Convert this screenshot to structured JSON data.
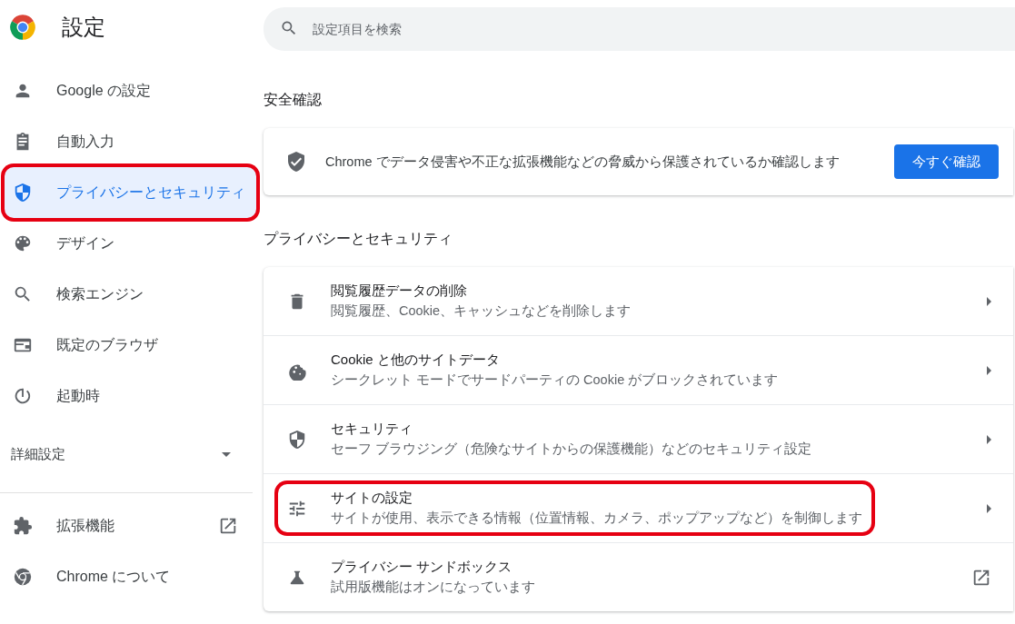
{
  "header": {
    "title": "設定"
  },
  "search": {
    "placeholder": "設定項目を検索"
  },
  "sidebar": {
    "items": [
      {
        "label": "Google の設定",
        "selected": false,
        "highlighted": false
      },
      {
        "label": "自動入力",
        "selected": false,
        "highlighted": false
      },
      {
        "label": "プライバシーとセキュリティ",
        "selected": true,
        "highlighted": true
      },
      {
        "label": "デザイン",
        "selected": false,
        "highlighted": false
      },
      {
        "label": "検索エンジン",
        "selected": false,
        "highlighted": false
      },
      {
        "label": "既定のブラウザ",
        "selected": false,
        "highlighted": false
      },
      {
        "label": "起動時",
        "selected": false,
        "highlighted": false
      }
    ],
    "advanced": {
      "label": "詳細設定",
      "expanded": false
    },
    "footer_items": [
      {
        "label": "拡張機能",
        "external": true
      },
      {
        "label": "Chrome について",
        "external": false
      }
    ]
  },
  "safety_check": {
    "heading": "安全確認",
    "text": "Chrome でデータ侵害や不正な拡張機能などの脅威から保護されているか確認します",
    "button": "今すぐ確認"
  },
  "privacy": {
    "heading": "プライバシーとセキュリティ",
    "rows": [
      {
        "title": "閲覧履歴データの削除",
        "subtitle": "閲覧履歴、Cookie、キャッシュなどを削除します",
        "kind": "arrow",
        "highlighted": false
      },
      {
        "title": "Cookie と他のサイトデータ",
        "subtitle": "シークレット モードでサードパーティの Cookie がブロックされています",
        "kind": "arrow",
        "highlighted": false
      },
      {
        "title": "セキュリティ",
        "subtitle": "セーフ ブラウジング（危険なサイトからの保護機能）などのセキュリティ設定",
        "kind": "arrow",
        "highlighted": false
      },
      {
        "title": "サイトの設定",
        "subtitle": "サイトが使用、表示できる情報（位置情報、カメラ、ポップアップなど）を制御します",
        "kind": "arrow",
        "highlighted": true
      },
      {
        "title": "プライバシー サンドボックス",
        "subtitle": "試用版機能はオンになっています",
        "kind": "external",
        "highlighted": false
      }
    ]
  }
}
